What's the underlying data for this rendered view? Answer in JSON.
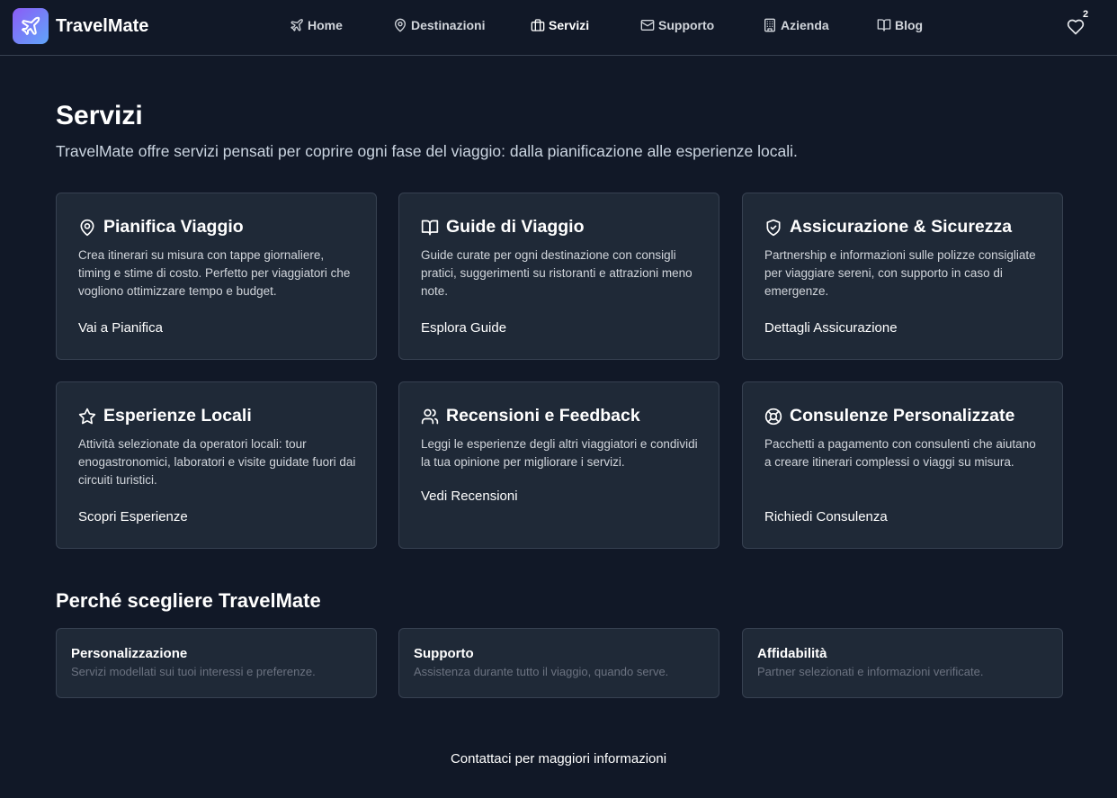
{
  "header": {
    "logo_text": "TravelMate",
    "nav": [
      {
        "label": "Home",
        "icon": "plane-icon"
      },
      {
        "label": "Destinazioni",
        "icon": "map-pin-icon"
      },
      {
        "label": "Servizi",
        "icon": "briefcase-icon",
        "active": true
      },
      {
        "label": "Supporto",
        "icon": "mail-icon"
      },
      {
        "label": "Azienda",
        "icon": "building-icon"
      },
      {
        "label": "Blog",
        "icon": "book-open-icon"
      }
    ],
    "favorites_count": "2"
  },
  "main": {
    "title": "Servizi",
    "subtitle": "TravelMate offre servizi pensati per coprire ogni fase del viaggio: dalla pianificazione alle esperienze locali.",
    "services": [
      {
        "title": "Pianifica Viaggio",
        "icon": "map-pin-icon",
        "description": "Crea itinerari su misura con tappe giornaliere, timing e stime di costo. Perfetto per viaggiatori che vogliono ottimizzare tempo e budget.",
        "link": "Vai a Pianifica"
      },
      {
        "title": "Guide di Viaggio",
        "icon": "book-open-icon",
        "description": "Guide curate per ogni destinazione con consigli pratici, suggerimenti su ristoranti e attrazioni meno note.",
        "link": "Esplora Guide"
      },
      {
        "title": "Assicurazione & Sicurezza",
        "icon": "shield-check-icon",
        "description": "Partnership e informazioni sulle polizze consigliate per viaggiare sereni, con supporto in caso di emergenze.",
        "link": "Dettagli Assicurazione"
      },
      {
        "title": "Esperienze Locali",
        "icon": "star-icon",
        "description": "Attività selezionate da operatori locali: tour enogastronomici, laboratori e visite guidate fuori dai circuiti turistici.",
        "link": "Scopri Esperienze"
      },
      {
        "title": "Recensioni e Feedback",
        "icon": "users-icon",
        "description": "Leggi le esperienze degli altri viaggiatori e condividi la tua opinione per migliorare i servizi.",
        "link": "Vedi Recensioni"
      },
      {
        "title": "Consulenze Personalizzate",
        "icon": "life-buoy-icon",
        "description": "Pacchetti a pagamento con consulenti che aiutano a creare itinerari complessi o viaggi su misura.",
        "link": "Richiedi Consulenza"
      }
    ],
    "why_title": "Perché scegliere TravelMate",
    "why": [
      {
        "title": "Personalizzazione",
        "description": "Servizi modellati sui tuoi interessi e preferenze."
      },
      {
        "title": "Supporto",
        "description": "Assistenza durante tutto il viaggio, quando serve."
      },
      {
        "title": "Affidabilità",
        "description": "Partner selezionati e informazioni verificate."
      }
    ],
    "contact_link": "Contattaci per maggiori informazioni"
  }
}
